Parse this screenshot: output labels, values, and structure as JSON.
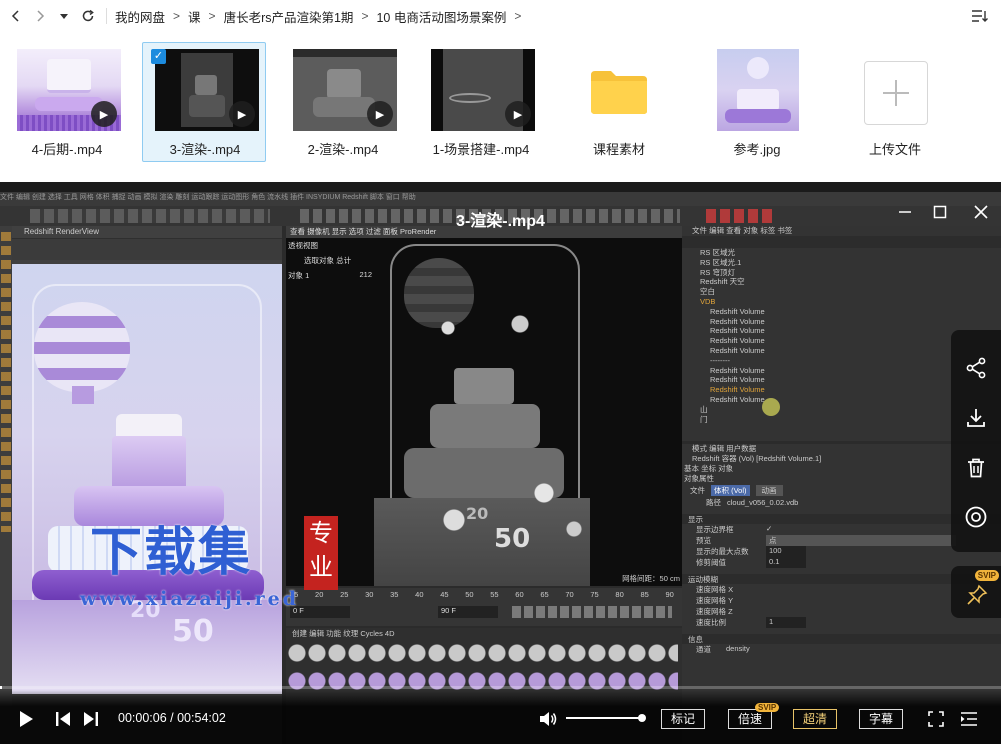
{
  "nav": {
    "breadcrumbs": [
      "我的网盘",
      "课",
      "唐长老rs产品渲染第1期",
      "10 电商活动图场景案例"
    ]
  },
  "files": [
    {
      "name": "4-后期-.mp4",
      "type": "video"
    },
    {
      "name": "3-渲染-.mp4",
      "type": "video",
      "selected": true
    },
    {
      "name": "2-渲染-.mp4",
      "type": "video"
    },
    {
      "name": "1-场景搭建-.mp4",
      "type": "video"
    },
    {
      "name": "课程素材",
      "type": "folder"
    },
    {
      "name": "参考.jpg",
      "type": "image"
    },
    {
      "name": "上传文件",
      "type": "upload"
    }
  ],
  "player": {
    "title": "3-渲染-.mp4",
    "time_current": "00:00:06",
    "time_total": "00:54:02",
    "progress": 0.0019,
    "volume": 1.0,
    "buttons": {
      "bookmark": "标记",
      "speed": "倍速",
      "speed_badge": "SVIP",
      "quality": "超清",
      "subtitle": "字幕"
    },
    "pin_badge": "SVIP"
  },
  "watermark": {
    "main": "下载集",
    "seal": "专业",
    "url": "www.xiazaiji.red"
  },
  "c4d": {
    "menu": "文件 编辑 创建 选择 工具 网格 体积 捕捉 动画 模拟 渲染 雕刻 运动跟踪 运动图形 角色 流水线 插件 INSYDIUM Redshift 脚本 窗口 帮助",
    "renderview_title": "Redshift RenderView",
    "viewport_tabs": "查看 摄像机 显示 选项 过滤 面板 ProRender",
    "viewport_mode": "透视视图",
    "viewport_info_label": "选取对象 总计",
    "viewport_info_row": "对象 1",
    "viewport_info_value": "212",
    "viewport_grid": "网格间距：50 cm",
    "object_manager_tabs": "文件 编辑 查看 对象 标签 书签",
    "objects": [
      "RS 区域光",
      "RS 区域光.1",
      "RS 穹顶灯",
      "Redshift 天空",
      "空白",
      "VDB",
      "Redshift Volume",
      "Redshift Volume",
      "Redshift Volume",
      "Redshift Volume",
      "Redshift Volume",
      "--------",
      "Redshift Volume",
      "Redshift Volume",
      "Redshift Volume",
      "Redshift Volume",
      "山",
      "门"
    ],
    "attr_tabs": "模式 编辑 用户数据",
    "attr_title": "Redshift 容器 (Vol) [Redshift Volume.1]",
    "attr_subtabs": "基本 坐标 对象",
    "attr_section": "对象属性",
    "attr_file_label": "文件",
    "attr_file_value": "体积 (Vol)",
    "attr_anim": "动画",
    "attr_path_label": "路径",
    "attr_path_value": "cloud_v056_0.02.vdb",
    "attr_display": "显示",
    "attr_rows": [
      {
        "label": "显示边界框",
        "value": "✓"
      },
      {
        "label": "预览",
        "value": "点"
      },
      {
        "label": "显示的最大点数",
        "value": "100"
      },
      {
        "label": "修剪阈值",
        "value": "0.1"
      }
    ],
    "attr_motion": "运动模糊",
    "motion_rows": [
      "速度网格 X",
      "速度网格 Y",
      "速度网格 Z",
      "速度比例"
    ],
    "motion_scale_value": "1",
    "attr_info": "信息",
    "info_row_label": "通道",
    "info_row_value": "density",
    "timeline_ticks": [
      "15",
      "20",
      "25",
      "30",
      "35",
      "40",
      "45",
      "50",
      "55",
      "60",
      "65",
      "70",
      "75",
      "80",
      "85",
      "90"
    ],
    "timeline_frame": "0 F",
    "timeline_end": "90 F",
    "material_tabs": "创建 编辑 功能 纹理 Cycles 4D"
  }
}
